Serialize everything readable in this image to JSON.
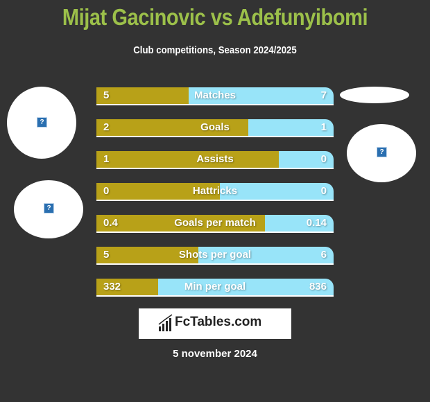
{
  "header": {
    "title": "Mijat Gacinovic vs Adefunyibomi",
    "subtitle": "Club competitions, Season 2024/2025"
  },
  "colors": {
    "left": "#b8a118",
    "right": "#98e4f9",
    "title": "#9cc04a",
    "background": "#333333"
  },
  "stats": [
    {
      "label": "Matches",
      "left": "5",
      "right": "7",
      "left_share": 0.39
    },
    {
      "label": "Goals",
      "left": "2",
      "right": "1",
      "left_share": 0.64
    },
    {
      "label": "Assists",
      "left": "1",
      "right": "0",
      "left_share": 0.77
    },
    {
      "label": "Hattricks",
      "left": "0",
      "right": "0",
      "left_share": 0.52
    },
    {
      "label": "Goals per match",
      "left": "0.4",
      "right": "0.14",
      "left_share": 0.71
    },
    {
      "label": "Shots per goal",
      "left": "5",
      "right": "6",
      "left_share": 0.43
    },
    {
      "label": "Min per goal",
      "left": "332",
      "right": "836",
      "left_share": 0.26
    }
  ],
  "logo": {
    "text": "FcTables.com"
  },
  "footer": {
    "date": "5 november 2024"
  },
  "icons": {
    "placeholder": "?"
  }
}
